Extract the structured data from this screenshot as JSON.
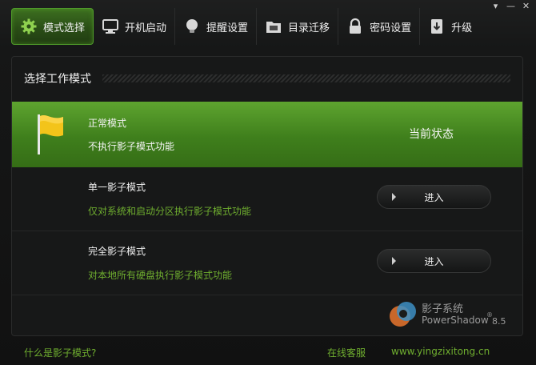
{
  "window": {
    "controls": [
      "▾",
      "—",
      "✕"
    ]
  },
  "tabs": [
    {
      "label": "模式选择",
      "icon": "gear-icon",
      "active": true
    },
    {
      "label": "开机启动",
      "icon": "monitor-icon"
    },
    {
      "label": "提醒设置",
      "icon": "bulb-icon"
    },
    {
      "label": "目录迁移",
      "icon": "folder-icon"
    },
    {
      "label": "密码设置",
      "icon": "lock-icon"
    },
    {
      "label": "升级",
      "icon": "download-icon"
    }
  ],
  "panel": {
    "title": "选择工作模式",
    "modes": [
      {
        "name": "正常模式",
        "desc": "不执行影子模式功能",
        "status": "当前状态"
      },
      {
        "name": "单一影子模式",
        "desc": "仅对系统和启动分区执行影子模式功能",
        "button": "进入"
      },
      {
        "name": "完全影子模式",
        "desc": "对本地所有硬盘执行影子模式功能",
        "button": "进入"
      }
    ]
  },
  "brand": {
    "name": "影子系统",
    "en": "PowerShadow",
    "reg": "®",
    "version": "8.5"
  },
  "footer": {
    "help": "什么是影子模式?",
    "service": "在线客服",
    "website": "www.yingzixitong.cn"
  },
  "colors": {
    "accent": "#4f9b2a",
    "link": "#6fae2f",
    "flag": "#f3c41a"
  }
}
